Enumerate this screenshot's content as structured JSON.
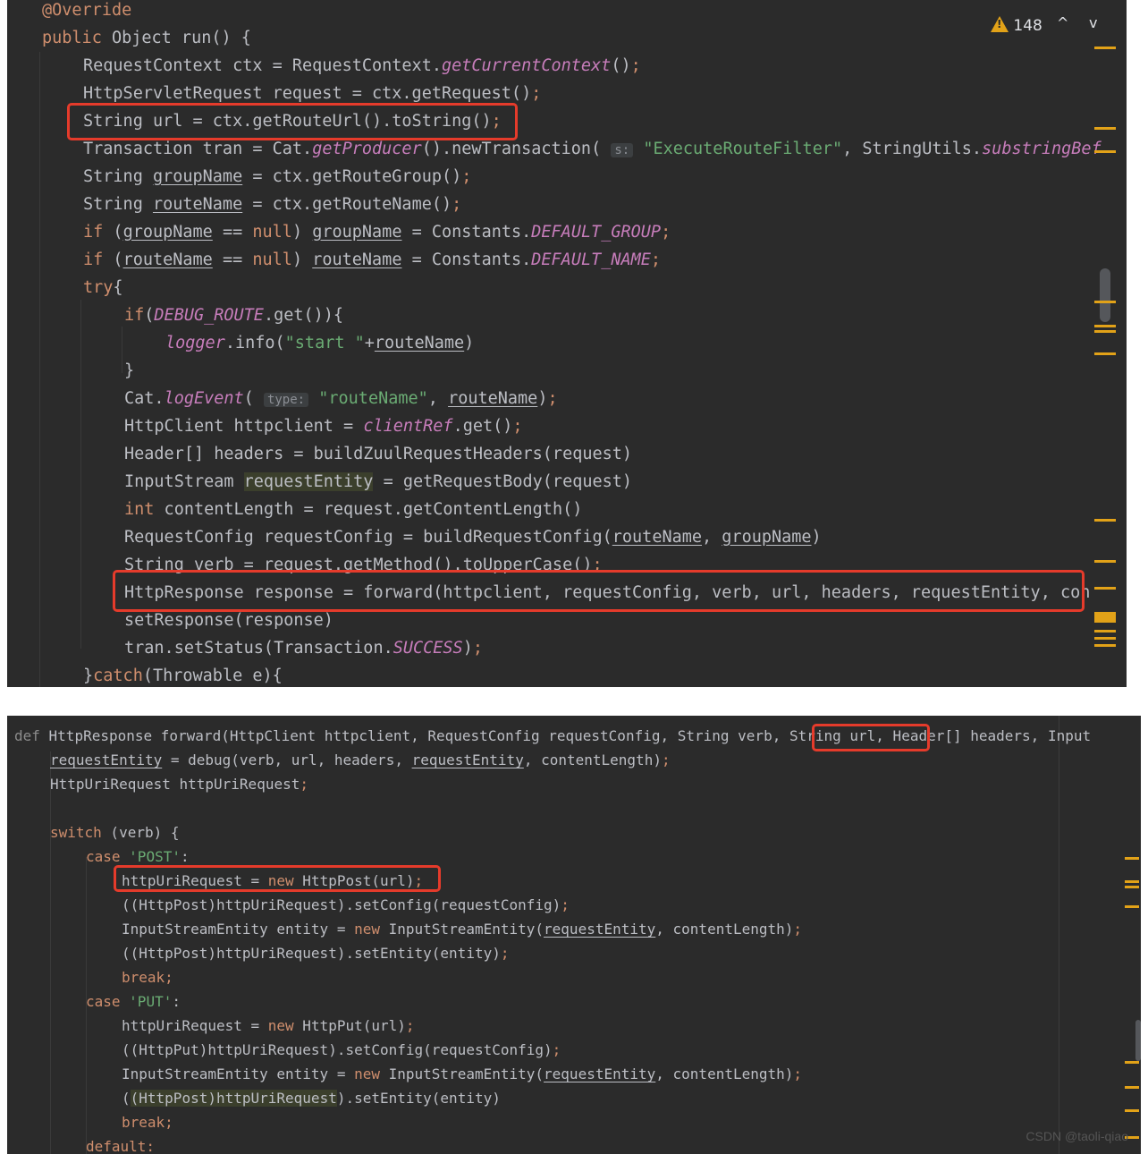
{
  "editor1": {
    "inspection_count": "148",
    "nav_up": "^",
    "nav_down": "v",
    "lines": [
      "@Override",
      "public Object run() {",
      "RequestContext ctx = RequestContext.getCurrentContext();",
      "HttpServletRequest request = ctx.getRequest();",
      "String url = ctx.getRouteUrl().toString();",
      "Transaction tran = Cat.getProducer().newTransaction( s: \"ExecuteRouteFilter\", StringUtils.substringBef",
      "String groupName = ctx.getRouteGroup();",
      "String routeName = ctx.getRouteName();",
      "if (groupName == null) groupName = Constants.DEFAULT_GROUP;",
      "if (routeName == null) routeName = Constants.DEFAULT_NAME;",
      "try{",
      "if(DEBUG_ROUTE.get()){",
      "logger.info(\"start \"+routeName)",
      "}",
      "Cat.logEvent( type: \"routeName\", routeName);",
      "HttpClient httpclient = clientRef.get();",
      "Header[] headers = buildZuulRequestHeaders(request)",
      "InputStream requestEntity = getRequestBody(request)",
      "int contentLength = request.getContentLength()",
      "RequestConfig requestConfig = buildRequestConfig(routeName, groupName)",
      "String verb = request.getMethod().toUpperCase();",
      "HttpResponse response = forward(httpclient, requestConfig, verb, url, headers, requestEntity, con",
      "setResponse(response)",
      "tran.setStatus(Transaction.SUCCESS);",
      "}catch(Throwable e){"
    ]
  },
  "editor2": {
    "lines": [
      "def HttpResponse forward(HttpClient httpclient, RequestConfig requestConfig, String verb, String url, Header[] headers, Input",
      "requestEntity = debug(verb, url, headers, requestEntity, contentLength);",
      "HttpUriRequest httpUriRequest;",
      "",
      "switch (verb) {",
      "case 'POST':",
      "httpUriRequest = new HttpPost(url);",
      "((HttpPost)httpUriRequest).setConfig(requestConfig);",
      "InputStreamEntity entity = new InputStreamEntity(requestEntity, contentLength);",
      "((HttpPost)httpUriRequest).setEntity(entity);",
      "break;",
      "case 'PUT':",
      "httpUriRequest = new HttpPut(url);",
      "((HttpPut)httpUriRequest).setConfig(requestConfig);",
      "InputStreamEntity entity = new InputStreamEntity(requestEntity, contentLength);",
      "((HttpPost)httpUriRequest).setEntity(entity)",
      "break;",
      "default:"
    ]
  },
  "watermark": "CSDN @taoli-qiao",
  "colors": {
    "background": "#2b2b2b",
    "keyword": "#cf8e6d",
    "string": "#6aab73",
    "static": "#c77dbb",
    "highlight_box": "#e53b2b",
    "marker": "#e2a218"
  }
}
